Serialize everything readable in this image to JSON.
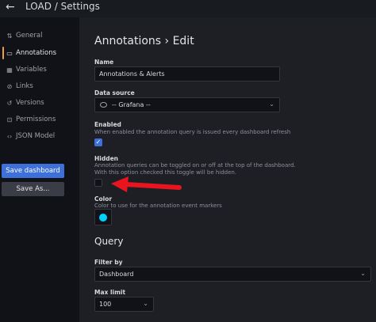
{
  "topbar": {
    "title": "LOAD / Settings",
    "back_icon": "arrow-left-icon"
  },
  "sidebar": {
    "items": [
      {
        "label": "General",
        "icon": "sliders-icon",
        "glyph": "⇅"
      },
      {
        "label": "Annotations",
        "icon": "comment-icon",
        "glyph": "▭"
      },
      {
        "label": "Variables",
        "icon": "calculator-icon",
        "glyph": "▦"
      },
      {
        "label": "Links",
        "icon": "link-icon",
        "glyph": "⊘"
      },
      {
        "label": "Versions",
        "icon": "history-icon",
        "glyph": "↺"
      },
      {
        "label": "Permissions",
        "icon": "lock-icon",
        "glyph": "⊡"
      },
      {
        "label": "JSON Model",
        "icon": "code-icon",
        "glyph": "‹›"
      }
    ],
    "save_dashboard": "Save dashboard",
    "save_as": "Save As..."
  },
  "main": {
    "heading": "Annotations › Edit",
    "name": {
      "label": "Name",
      "value": "Annotations & Alerts"
    },
    "datasource": {
      "label": "Data source",
      "value": "-- Grafana --"
    },
    "enabled": {
      "label": "Enabled",
      "description": "When enabled the annotation query is issued every dashboard refresh",
      "checked": true
    },
    "hidden": {
      "label": "Hidden",
      "description": "Annotation queries can be toggled on or off at the top of the dashboard. With this option checked this toggle will be hidden.",
      "checked": false
    },
    "color": {
      "label": "Color",
      "description": "Color to use for the annotation event markers",
      "value": "#00d1ff"
    },
    "query": {
      "title": "Query",
      "filter_by": {
        "label": "Filter by",
        "value": "Dashboard"
      },
      "max_limit": {
        "label": "Max limit",
        "value": "100"
      }
    }
  },
  "colors": {
    "accent": "#f59b44",
    "primary": "#3d71d9",
    "annotation_arrow": "#e8141f"
  }
}
